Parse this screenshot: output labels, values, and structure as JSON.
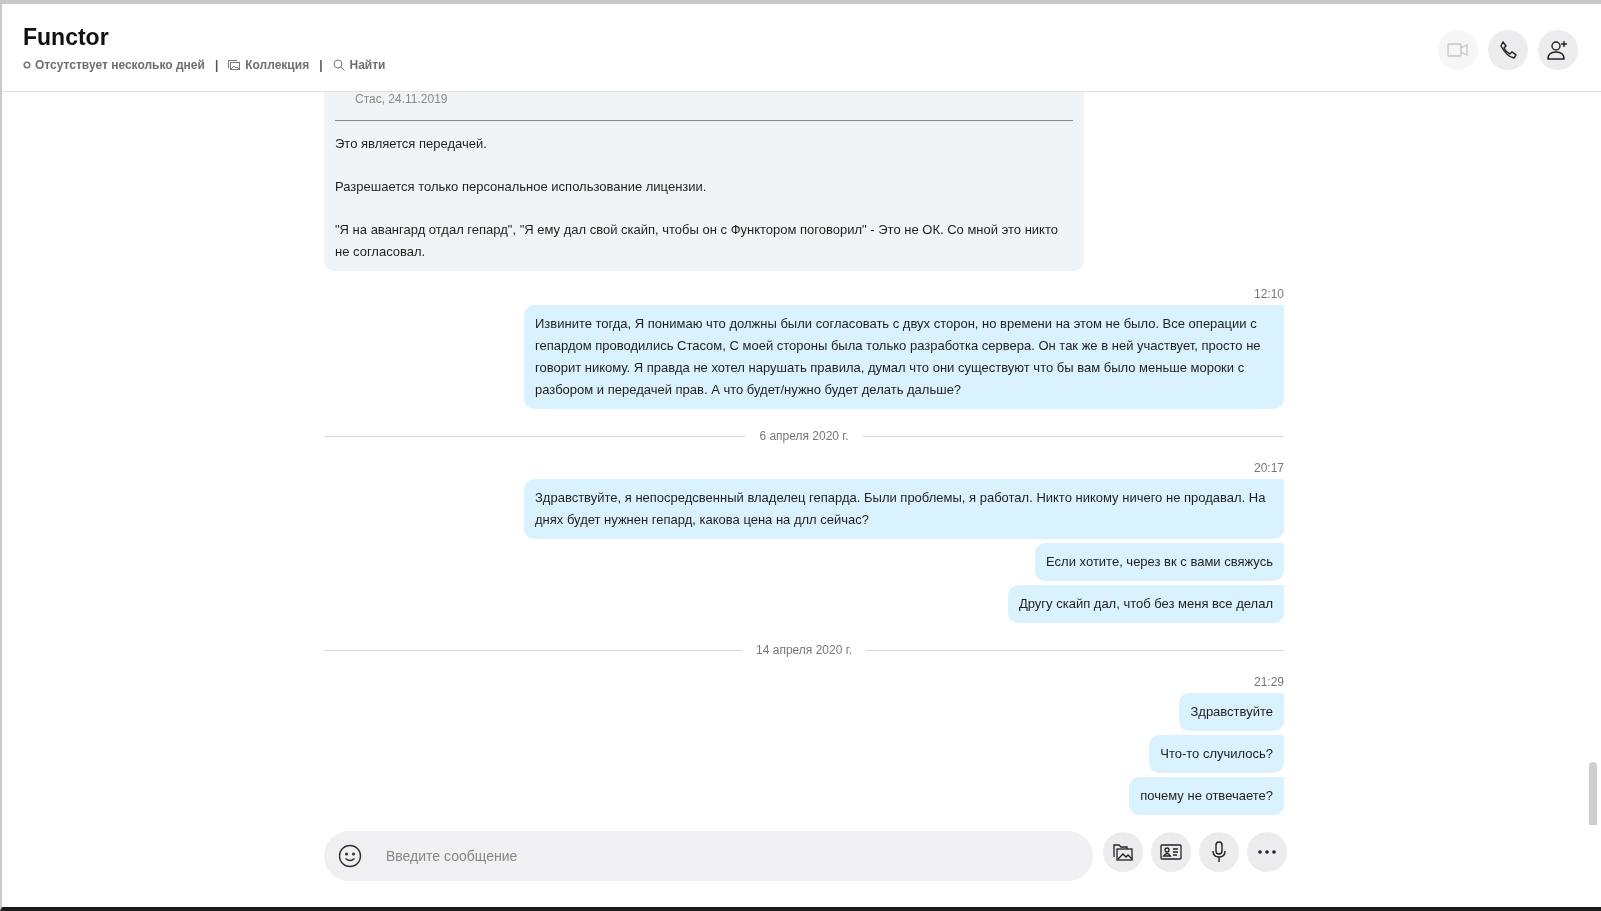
{
  "header": {
    "title": "Functor",
    "status": "Отсутствует несколько дней",
    "links": [
      {
        "kind": "collection",
        "separator": "|",
        "label": "Коллекция"
      },
      {
        "kind": "find",
        "separator": "|",
        "label": "Найти"
      }
    ],
    "call_buttons": [
      {
        "kind": "video",
        "disabled": true
      },
      {
        "kind": "audio",
        "disabled": false
      },
      {
        "kind": "add_person",
        "disabled": false
      }
    ]
  },
  "messages": [
    {
      "kind": "quote",
      "quote_author": "Стас, 24.11.2019",
      "paragraphs": [
        "Это является передачей.",
        "Разрешается только персональное использование лицензии.",
        "\"Я на авангард отдал гепард\", \"Я ему дал свой скайп, чтобы он с Функтором поговорил\" - Это не ОК. Со мной это никто не согласовал."
      ]
    },
    {
      "kind": "time",
      "text": "12:10"
    },
    {
      "kind": "outgoing",
      "text": "Извините тогда, Я понимаю что должны были согласовать с двух сторон, но времени на этом не было. Все операции с гепардом проводились Стасом, С моей стороны была только разработка сервера. Он так же в ней участвует, просто не говорит никому. Я правда не хотел нарушать правила, думал что они существуют что бы вам было меньше мороки с разбором и передачей прав. А что будет/нужно будет делать дальше?"
    },
    {
      "kind": "date",
      "text": "6 апреля 2020 г."
    },
    {
      "kind": "time",
      "text": "20:17"
    },
    {
      "kind": "outgoing",
      "text": "Здравствуйте, я непосредсвенный владелец гепарда. Были проблемы, я работал. Никто никому ничего не продавал. На днях будет нужнен гепард, какова цена на длл сейчас?"
    },
    {
      "kind": "outgoing",
      "text": "Если хотите, через вк с вами свяжусь"
    },
    {
      "kind": "outgoing",
      "text": "Другу скайп дал, чтоб без меня все делал"
    },
    {
      "kind": "date",
      "text": "14 апреля 2020 г."
    },
    {
      "kind": "time",
      "text": "21:29"
    },
    {
      "kind": "outgoing",
      "text": "Здравствуйте"
    },
    {
      "kind": "outgoing",
      "text": "Что-то случилось?"
    },
    {
      "kind": "outgoing",
      "text": "почему не отвечаете?"
    }
  ],
  "composer": {
    "placeholder": "Введите сообщение"
  }
}
